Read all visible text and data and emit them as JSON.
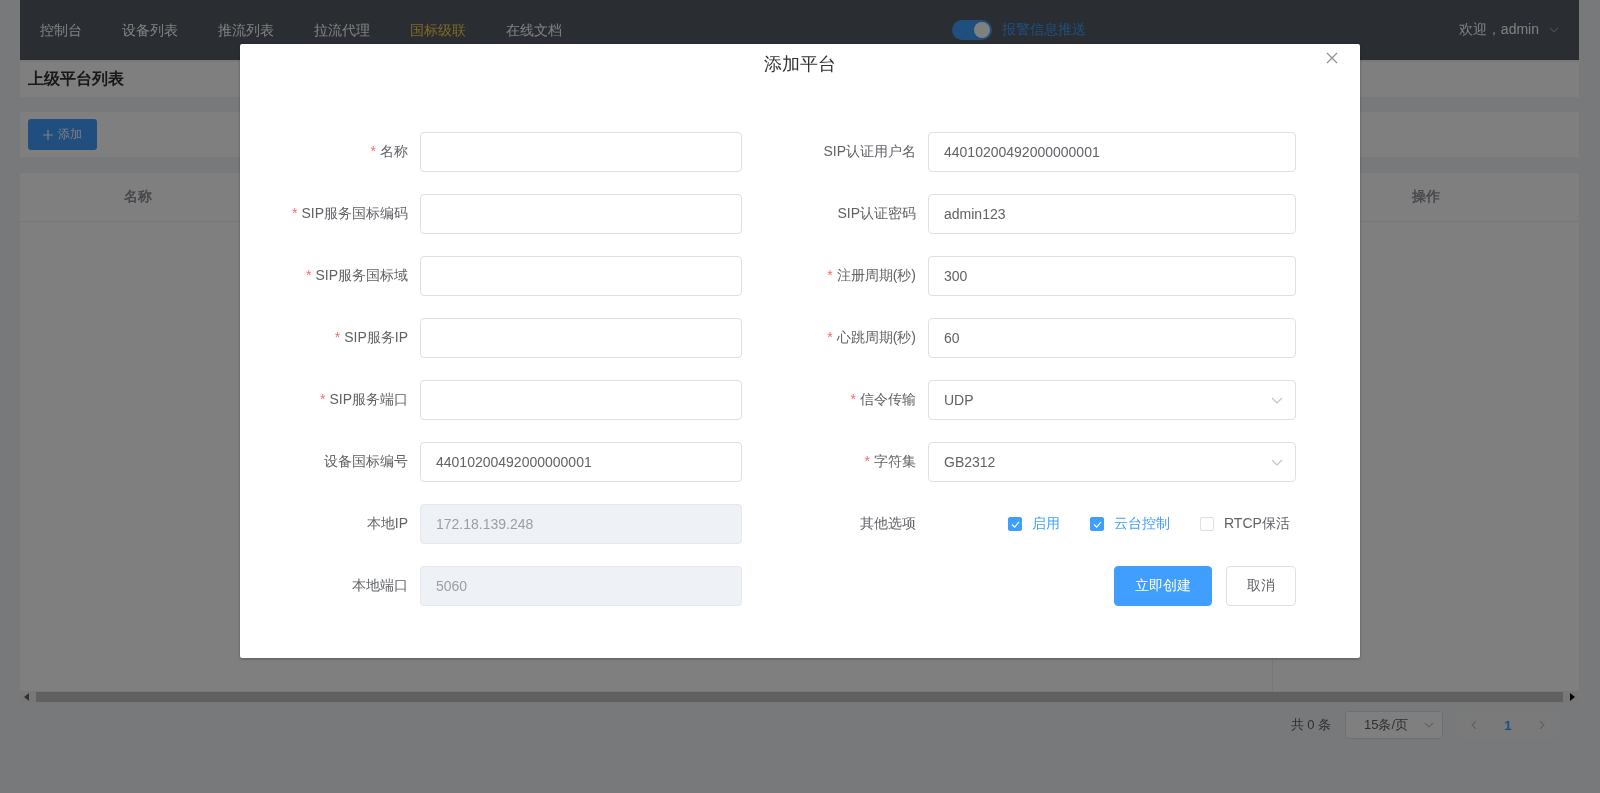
{
  "nav": {
    "items": [
      {
        "label": "控制台",
        "selected": false
      },
      {
        "label": "设备列表",
        "selected": false
      },
      {
        "label": "推流列表",
        "selected": false
      },
      {
        "label": "拉流代理",
        "selected": false
      },
      {
        "label": "国标级联",
        "selected": true
      },
      {
        "label": "在线文档",
        "selected": false
      }
    ],
    "alarm_switch": {
      "label": "报警信息推送",
      "on": true
    },
    "user": "欢迎，admin"
  },
  "page": {
    "title": "上级平台列表",
    "add_button": "添加",
    "table": {
      "columns": [
        "名称",
        "操作"
      ]
    },
    "pagination": {
      "total": "共 0 条",
      "page_size": "15条/页",
      "pages": [
        {
          "label": "1",
          "selected": true
        }
      ]
    }
  },
  "dialog": {
    "title": "添加平台",
    "left_fields": [
      {
        "mark": "*",
        "label": "名称",
        "kind": "input",
        "disabled": false
      },
      {
        "mark": "*",
        "label": "SIP服务国标编码",
        "kind": "input",
        "disabled": false
      },
      {
        "mark": "*",
        "label": "SIP服务国标域",
        "kind": "input",
        "disabled": false
      },
      {
        "mark": "*",
        "label": "SIP服务IP",
        "kind": "input",
        "disabled": false
      },
      {
        "mark": "*",
        "label": "SIP服务端口",
        "kind": "input",
        "disabled": false
      },
      {
        "label": "设备国标编号",
        "kind": "input",
        "value": "44010200492000000001",
        "disabled": false
      },
      {
        "label": "本地IP",
        "kind": "input",
        "value": "172.18.139.248",
        "disabled": true
      },
      {
        "label": "本地端口",
        "kind": "input",
        "value": "5060",
        "disabled": true
      }
    ],
    "right_fields": [
      {
        "label": "SIP认证用户名",
        "kind": "input",
        "value": "44010200492000000001",
        "disabled": false
      },
      {
        "label": "SIP认证密码",
        "kind": "input",
        "value": "admin123",
        "disabled": false
      },
      {
        "mark": "*",
        "label": "注册周期(秒)",
        "kind": "input",
        "value": "300",
        "disabled": false
      },
      {
        "mark": "*",
        "label": "心跳周期(秒)",
        "kind": "input",
        "value": "60",
        "disabled": false
      },
      {
        "mark": "*",
        "label": "信令传输",
        "kind": "select",
        "value": "UDP",
        "disabled": false
      },
      {
        "mark": "*",
        "label": "字符集",
        "kind": "select",
        "value": "GB2312",
        "disabled": false
      }
    ],
    "options": {
      "label": "其他选项",
      "items": [
        {
          "label": "启用",
          "checked": true
        },
        {
          "label": "云台控制",
          "checked": true
        },
        {
          "label": "RTCP保活",
          "checked": false
        }
      ]
    },
    "buttons": [
      {
        "label": "立即创建",
        "kind": "primary"
      },
      {
        "label": "取消",
        "kind": "default"
      }
    ]
  }
}
